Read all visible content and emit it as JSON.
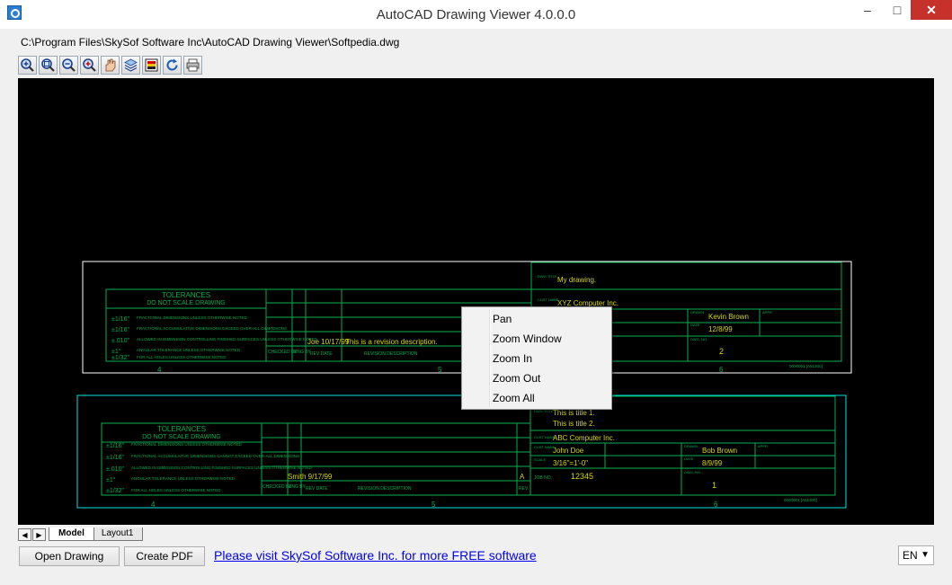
{
  "window": {
    "title": "AutoCAD Drawing Viewer 4.0.0.0",
    "minimize": "–",
    "maximize": "□",
    "close": "✕"
  },
  "file_path": "C:\\Program Files\\SkySof Software Inc\\AutoCAD Drawing Viewer\\Softpedia.dwg",
  "toolbar": [
    {
      "name": "zoom-in-icon"
    },
    {
      "name": "zoom-window-icon"
    },
    {
      "name": "zoom-out-icon"
    },
    {
      "name": "zoom-extents-icon"
    },
    {
      "name": "pan-icon"
    },
    {
      "name": "layers-icon"
    },
    {
      "name": "color-icon"
    },
    {
      "name": "refresh-icon"
    },
    {
      "name": "print-icon"
    }
  ],
  "drawing": {
    "upper": {
      "tolerances_title": "TOLERANCES",
      "do_not_scale": "DO NOT SCALE DRAWING",
      "tol_rows": [
        {
          "value": "±1/16\"",
          "desc": "FRACTIONAL DIMENSIONS UNLESS OTHERWISE NOTED"
        },
        {
          "value": "±1/16\"",
          "desc": "FRACTIONAL ACCUMULATIVE DIMENSIONS EXCEED OVER-ALL DIMENSIONS"
        },
        {
          "value": "±.010\"",
          "desc": "ALLOWED IN DIMENSION CONTROLLING FINISHED SURFACES UNLESS OTHERWISE NOTED"
        },
        {
          "value": "±1°",
          "desc": "ANGULAR TOLERANCE UNLESS OTHERWISE NOTED"
        },
        {
          "value": "±1/32\"",
          "desc": "FOR ALL HOLES UNLESS OTHERWISE NOTED"
        }
      ],
      "checked_by": "CHECKED BY",
      "eng_by": "ENG BY",
      "rev_date": "REV DATE",
      "rev_desc": "REVISION DESCRIPTION",
      "revision_entry": "Joe 10/17/99",
      "revision_text": "This is a revision description.",
      "title_label": "DWG TITLE",
      "title_value": "My drawing.",
      "cust_label": "CUST NAME",
      "cust_value": "XYZ Computer Inc.",
      "drawn_label": "DRAWN",
      "drawn_value": "Kevin Brown",
      "date_label": "DATE",
      "date_value": "12/8/99",
      "appr_label": "APPR.",
      "dwg_no_label": "DWG. NO.",
      "dwg_no_value": "2",
      "zone_4": "4",
      "zone_5": "5",
      "zone_6": "6",
      "footer_code": "0000001 [A51300]"
    },
    "lower": {
      "tolerances_title": "TOLERANCES",
      "do_not_scale": "DO NOT SCALE DRAWING",
      "tol_rows": [
        {
          "value": "±1/16\"",
          "desc": "FRACTIONAL DIMENSIONS UNLESS OTHERWISE NOTED"
        },
        {
          "value": "±1/16\"",
          "desc": "FRACTIONAL ACCUMULATIVE DIMENSIONS CANNOT EXCEED OVER-ALL DIMENSIONS"
        },
        {
          "value": "±.010\"",
          "desc": "ALLOWED IN DIMENSION CONTROLLING FINISHED SURFACES UNLESS OTHERWISE NOTED"
        },
        {
          "value": "±1°",
          "desc": "ANGULAR TOLERANCE UNLESS OTHERWISE NOTED"
        },
        {
          "value": "±1/32\"",
          "desc": "FOR ALL HOLES UNLESS OTHERWISE NOTED"
        }
      ],
      "checked_by": "CHECKED BY",
      "eng_by": "ENG BY",
      "rev_date": "REV DATE",
      "rev_desc": "REVISION DESCRIPTION",
      "rev_label": "REV.",
      "revision_entry": "Smith 9/17/99",
      "rev_letter": "A",
      "title_label": "DWG TITLE",
      "title_line1": "This is title 1.",
      "title_line2": "This is title 2.",
      "cust_label": "CUST NAME",
      "cust_value": "ABC Computer Inc.",
      "cust_contact_label": "CUST NAME",
      "cust_contact": "John Doe",
      "scale_label": "SCALE",
      "scale_value": "3/16\"=1'-0\"",
      "drawn_label": "DRAWN",
      "drawn_value": "Bob Brown",
      "date_label": "DATE",
      "date_value": "8/9/99",
      "appr_label": "APPR.",
      "job_label": "JOB NO.",
      "job_value": "12345",
      "dwg_no_label": "DWG. NO.",
      "dwg_no_value": "1",
      "zone_4": "4",
      "zone_5": "5",
      "zone_6": "6",
      "footer_code": "0000001 [A51300]"
    }
  },
  "context_menu": [
    "Pan",
    "Zoom Window",
    "Zoom In",
    "Zoom Out",
    "Zoom All"
  ],
  "layout_tabs": {
    "prev": "◀",
    "next": "▶",
    "tabs": [
      "Model",
      "Layout1"
    ]
  },
  "buttons": {
    "open": "Open Drawing",
    "pdf": "Create PDF"
  },
  "link_text": "Please visit SkySof Software Inc. for more FREE software",
  "language": {
    "selected": "EN",
    "arrow": "▼"
  },
  "colors": {
    "canvas": "#000000",
    "cad_green": "#00b050",
    "cad_white": "#ffffff",
    "cad_cyan": "#00e0e0",
    "cad_yellow": "#d8d800",
    "close_red": "#c7312b",
    "link": "#0000ee"
  }
}
